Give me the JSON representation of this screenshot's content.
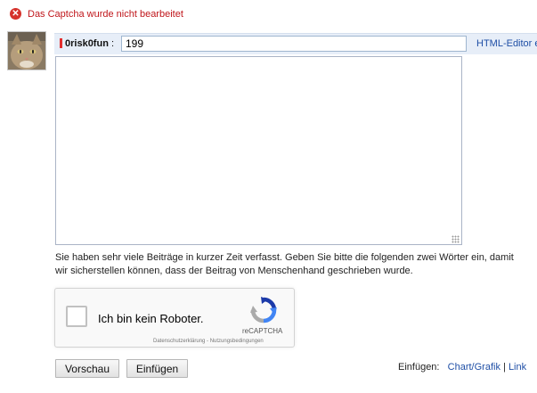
{
  "error": {
    "message": "Das Captcha wurde nicht bearbeitet",
    "icon": "error-circle-x"
  },
  "author": {
    "name": "0risk0fun",
    "colon": ":"
  },
  "title_field": {
    "value": "199"
  },
  "editor_link": "HTML-Editor ei",
  "body_field": {
    "value": ""
  },
  "notice": "Sie haben sehr viele Beiträge in kurzer Zeit verfasst. Geben Sie bitte die folgenden zwei Wörter ein, damit wir sicherstellen können, dass der Beitrag von Menschenhand geschrieben wurde.",
  "recaptcha": {
    "label": "Ich bin kein Roboter.",
    "brand": "reCAPTCHA",
    "links": "Datenschutzerklärung - Nutzungsbedingungen"
  },
  "buttons": {
    "preview": "Vorschau",
    "insert": "Einfügen"
  },
  "insert_bar": {
    "label": "Einfügen:",
    "chart_link": "Chart/Grafik",
    "separator": "|",
    "link_link": "Link"
  },
  "colors": {
    "error": "#c0161b",
    "link": "#1f4fa6",
    "name_bar": "#e7eef8",
    "marker": "#e22e2e"
  }
}
